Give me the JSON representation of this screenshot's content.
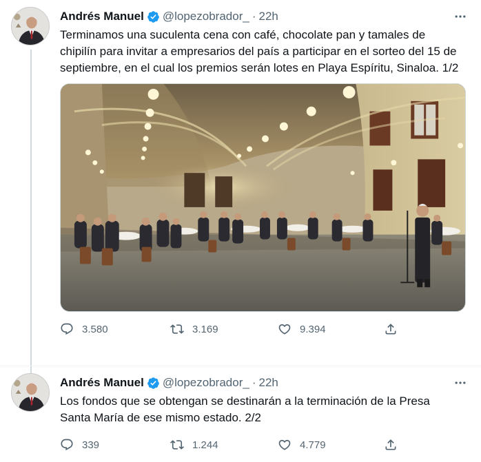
{
  "colors": {
    "verified": "#1d9bf0",
    "text": "#0f1419",
    "secondary": "#536471",
    "thread_line": "#cfd9de"
  },
  "tweets": [
    {
      "author_name": "Andrés Manuel",
      "handle": "@lopezobrador_",
      "separator": "·",
      "time": "22h",
      "text": "Terminamos una suculenta cena con café, chocolate pan y tamales de chipilín para invitar a empresarios del país a participar en el sorteo del 15 de septiembre, en el cual los premios serán lotes en Playa Espíritu, Sinaloa. 1/2",
      "replies": "3.580",
      "retweets": "3.169",
      "likes": "9.394",
      "has_media": true,
      "media_description": "photo-of-dinner-in-palace-hall"
    },
    {
      "author_name": "Andrés Manuel",
      "handle": "@lopezobrador_",
      "separator": "·",
      "time": "22h",
      "text": "Los fondos que se obtengan se destinarán a la terminación de la Presa Santa María de ese mismo estado. 2/2",
      "replies": "339",
      "retweets": "1.244",
      "likes": "4.779",
      "has_media": false
    }
  ],
  "icons": {
    "more": "more-dots-icon",
    "verified": "verified-badge-icon",
    "reply": "reply-icon",
    "retweet": "retweet-icon",
    "like": "heart-icon",
    "share": "share-icon"
  }
}
